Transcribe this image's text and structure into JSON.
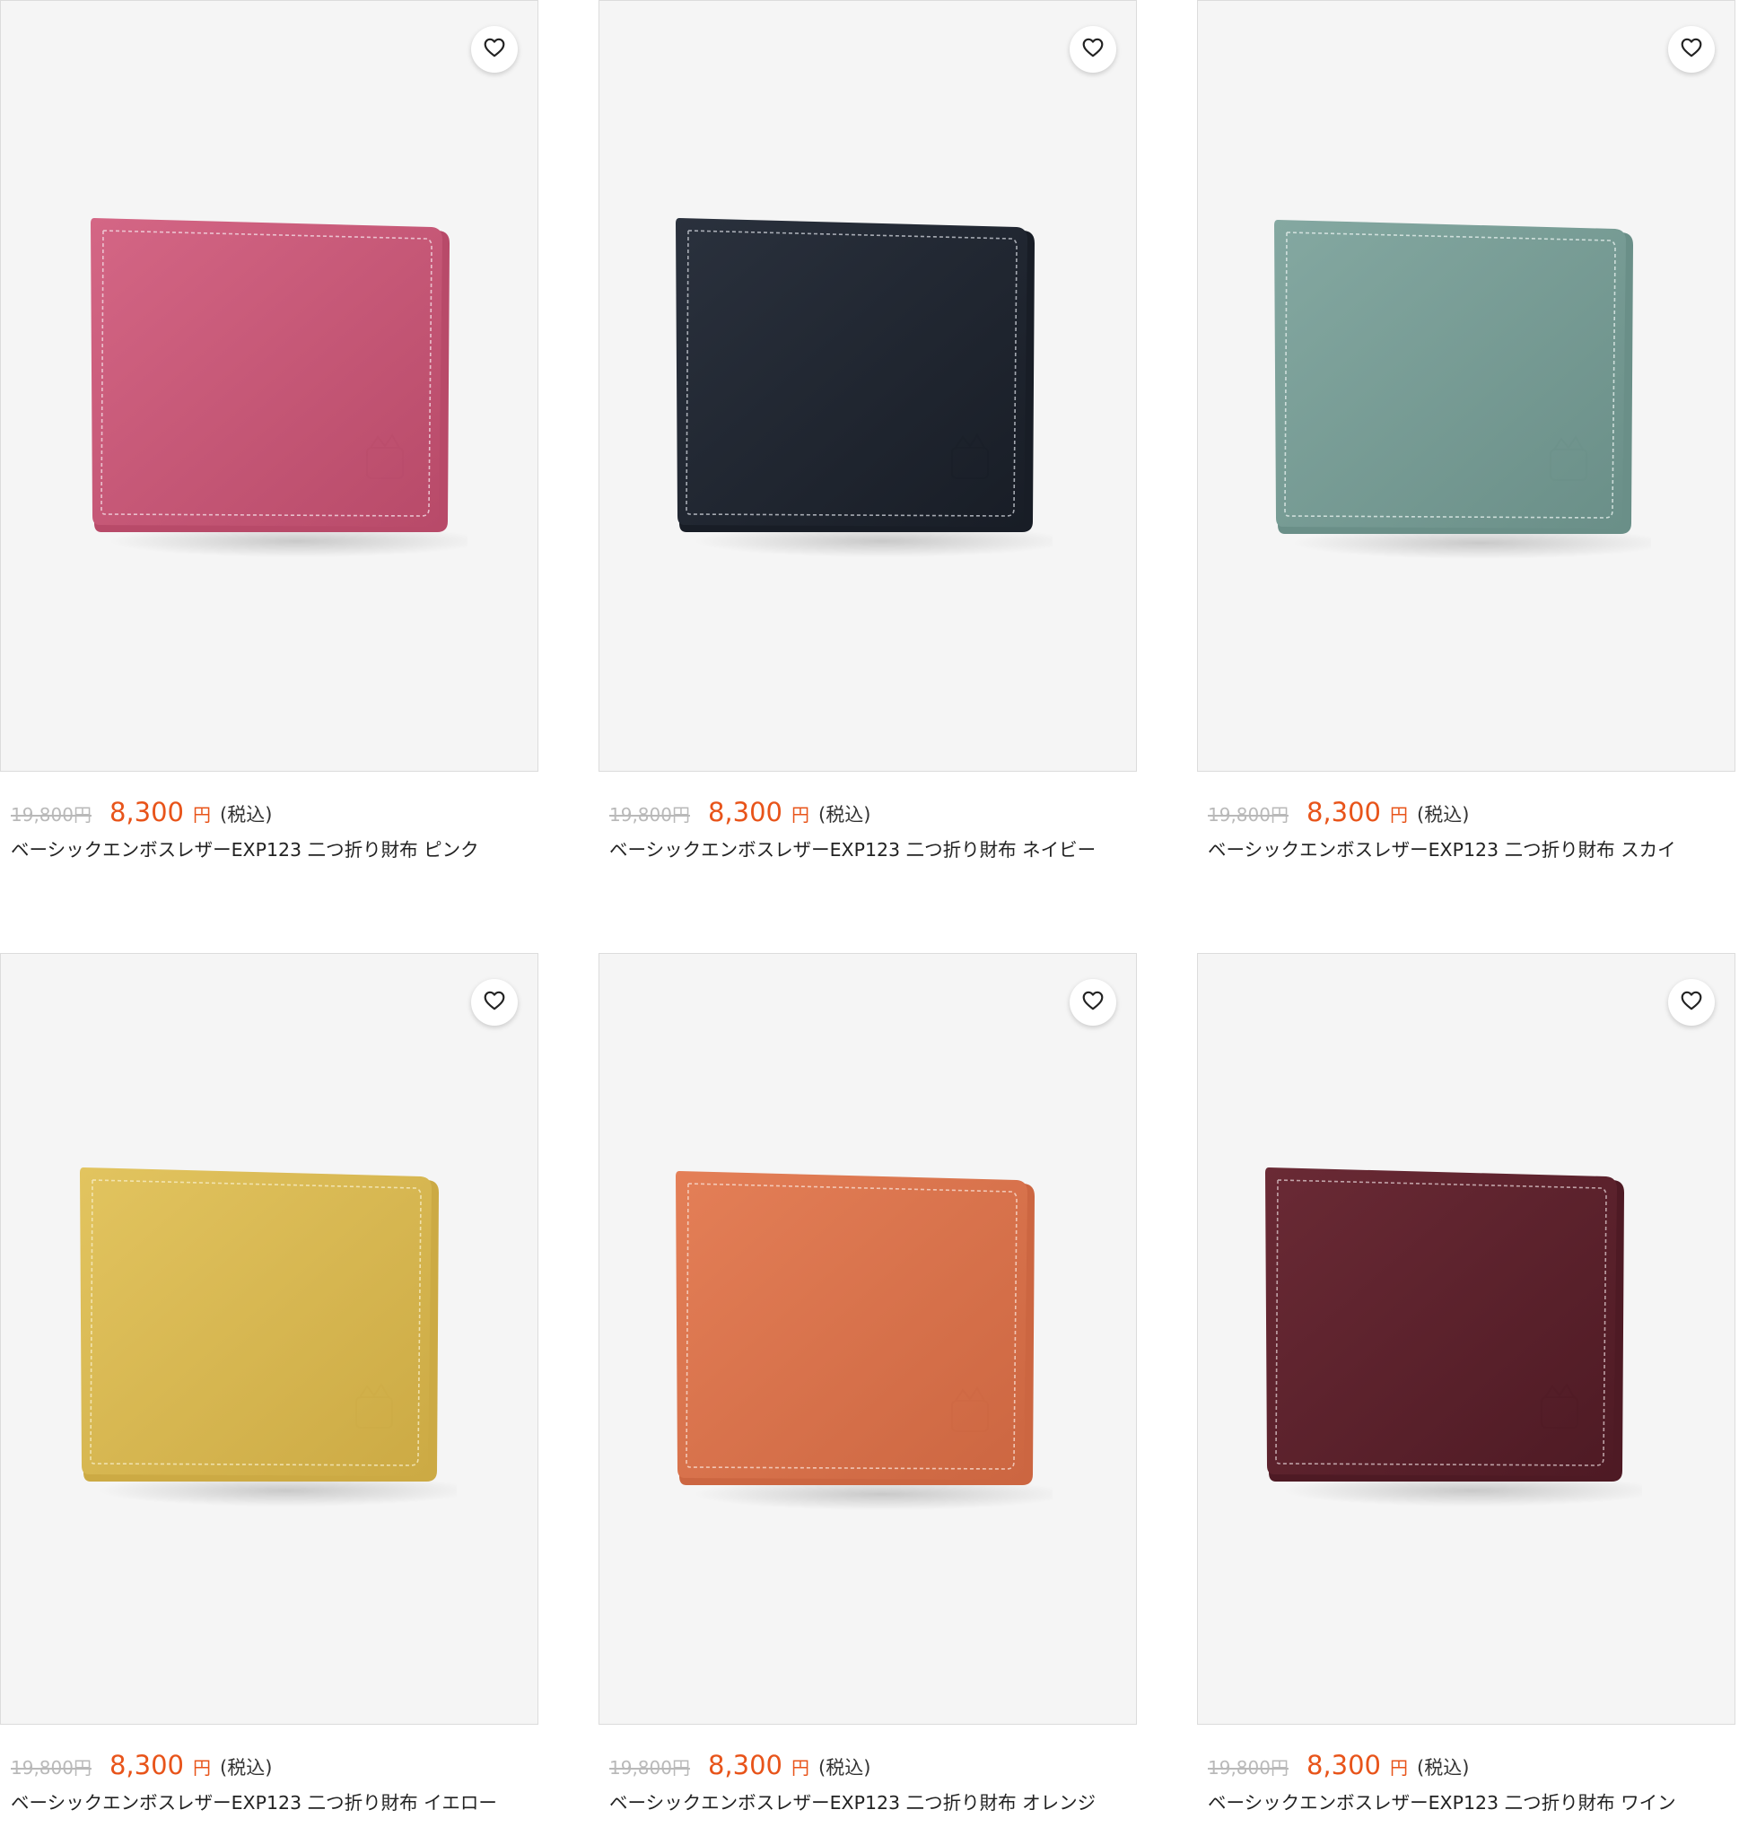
{
  "heart_icon_color": "#222222",
  "products": [
    {
      "old_price": "19,800円",
      "new_price": "8,300",
      "yen": "円",
      "tax": "(税込)",
      "title": "ベーシックエンボスレザーEXP123 二つ折り財布 ピンク",
      "color": "#d46685",
      "color_dark": "#b84a69",
      "stitch": "#f3dbe3"
    },
    {
      "old_price": "19,800円",
      "new_price": "8,300",
      "yen": "円",
      "tax": "(税込)",
      "title": "ベーシックエンボスレザーEXP123 二つ折り財布 ネイビー",
      "color": "#2a313d",
      "color_dark": "#181d26",
      "stitch": "#c9cdd4"
    },
    {
      "old_price": "19,800円",
      "new_price": "8,300",
      "yen": "円",
      "tax": "(税込)",
      "title": "ベーシックエンボスレザーEXP123 二つ折り財布 スカイ",
      "color": "#84a8a1",
      "color_dark": "#6a8f88",
      "stitch": "#e4eeeb"
    },
    {
      "old_price": "19,800円",
      "new_price": "8,300",
      "yen": "円",
      "tax": "(税込)",
      "title": "ベーシックエンボスレザーEXP123 二つ折り財布 イエロー",
      "color": "#e2c45f",
      "color_dark": "#ccaa44",
      "stitch": "#f6ecc4"
    },
    {
      "old_price": "19,800円",
      "new_price": "8,300",
      "yen": "円",
      "tax": "(税込)",
      "title": "ベーシックエンボスレザーEXP123 二つ折り財布 オレンジ",
      "color": "#e47f57",
      "color_dark": "#cc6641",
      "stitch": "#f7dccf"
    },
    {
      "old_price": "19,800円",
      "new_price": "8,300",
      "yen": "円",
      "tax": "(税込)",
      "title": "ベーシックエンボスレザーEXP123 二つ折り財布 ワイン",
      "color": "#6a2a35",
      "color_dark": "#4e1a24",
      "stitch": "#d8c3c7"
    }
  ]
}
